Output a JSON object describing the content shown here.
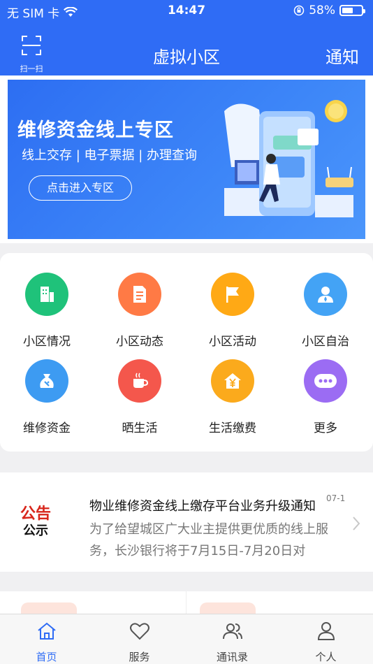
{
  "status_bar": {
    "carrier": "无 SIM 卡",
    "time": "14:47",
    "battery": "58%",
    "battery_level": 0.58
  },
  "header": {
    "scan_label": "扫一扫",
    "title": "虚拟小区",
    "notice_label": "通知"
  },
  "banner": {
    "title": "维修资金线上专区",
    "subtitle": "线上交存 | 电子票据 | 办理查询",
    "button": "点击进入专区"
  },
  "grid": [
    {
      "label": "小区情况",
      "icon": "building-icon",
      "color": "#1fc27a"
    },
    {
      "label": "小区动态",
      "icon": "document-icon",
      "color": "#ff7a45"
    },
    {
      "label": "小区活动",
      "icon": "flag-icon",
      "color": "#ffa915"
    },
    {
      "label": "小区自治",
      "icon": "person-icon",
      "color": "#43a3f5"
    },
    {
      "label": "维修资金",
      "icon": "money-bag-icon",
      "color": "#3d9bf2"
    },
    {
      "label": "晒生活",
      "icon": "cup-icon",
      "color": "#f4574c"
    },
    {
      "label": "生活缴费",
      "icon": "house-yen-icon",
      "color": "#fbaa1c"
    },
    {
      "label": "更多",
      "icon": "more-icon",
      "color": "#9b6cf3"
    }
  ],
  "notice": {
    "logo_line1": "公告",
    "logo_line2": "公示",
    "title": "物业维修资金线上缴存平台业务升级通知",
    "date": "07-1",
    "body": "为了给望城区广大业主提供更优质的线上服务，长沙银行将于7月15日-7月20日对"
  },
  "tabs": [
    {
      "label": "首页",
      "icon": "home-icon",
      "active": true
    },
    {
      "label": "服务",
      "icon": "heart-icon",
      "active": false
    },
    {
      "label": "通讯录",
      "icon": "contacts-icon",
      "active": false
    },
    {
      "label": "个人",
      "icon": "user-icon",
      "active": false
    }
  ],
  "colors": {
    "primary": "#2f6cf5",
    "alert_red": "#d8261b"
  }
}
